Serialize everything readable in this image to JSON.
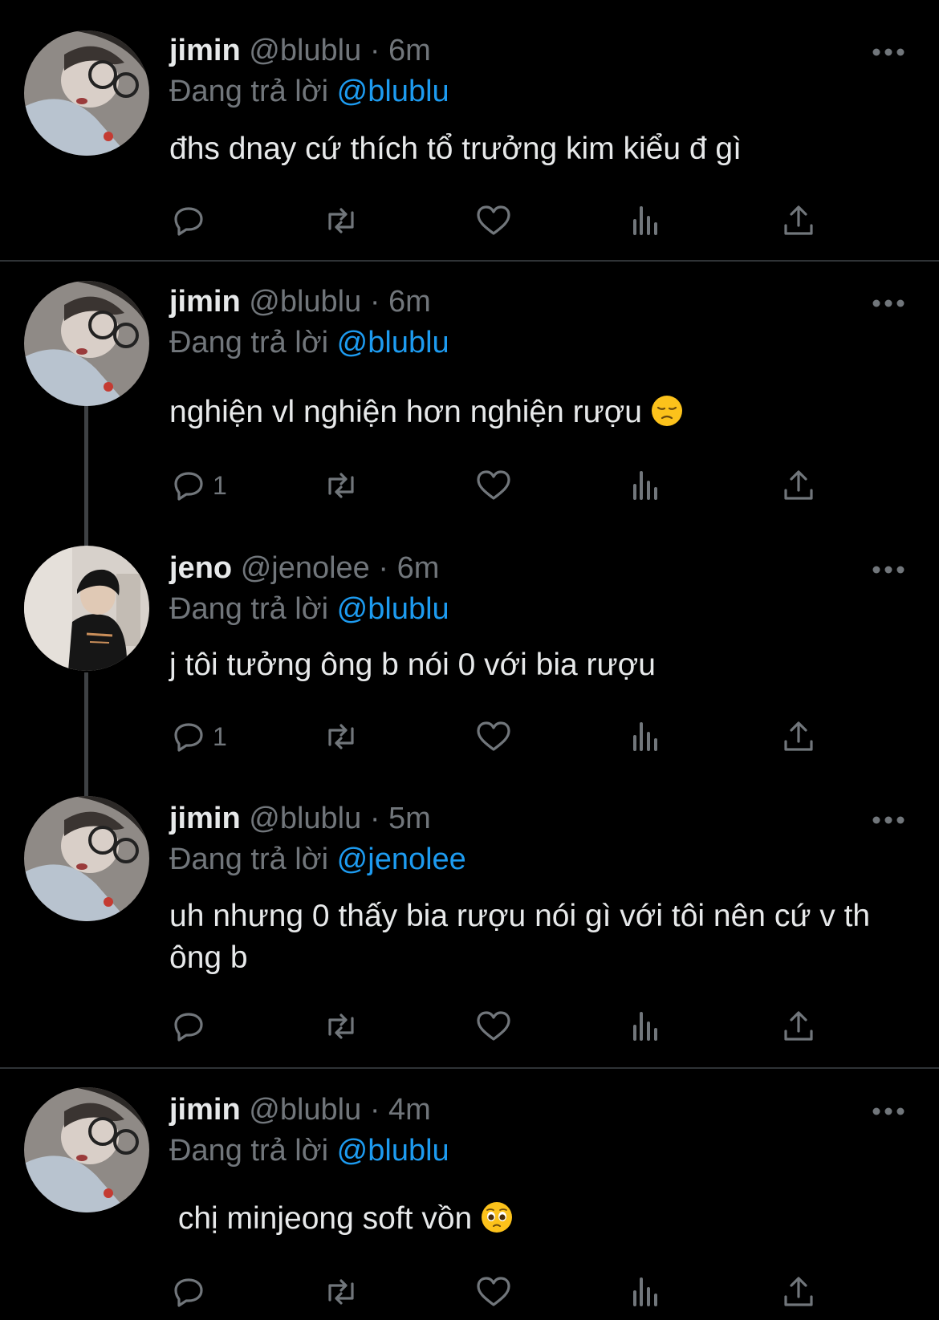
{
  "tweets": [
    {
      "name": "jimin",
      "handle": "@blublu",
      "time": "6m",
      "replying_label": "Đang trả lời",
      "replying_to": "@blublu",
      "text": "đhs dnay cứ thích tổ trưởng kim kiểu đ gì",
      "reply_count": "",
      "avatar": "jimin"
    },
    {
      "name": "jimin",
      "handle": "@blublu",
      "time": "6m",
      "replying_label": "Đang trả lời",
      "replying_to": "@blublu",
      "text": "nghiện vl nghiện hơn nghiện rượu",
      "emoji": "pensive-face",
      "reply_count": "1",
      "avatar": "jimin"
    },
    {
      "name": "jeno",
      "handle": "@jenolee",
      "time": "6m",
      "replying_label": "Đang trả lời",
      "replying_to": "@blublu",
      "text": "j tôi tưởng ông b nói 0 với bia rượu",
      "reply_count": "1",
      "avatar": "jeno"
    },
    {
      "name": "jimin",
      "handle": "@blublu",
      "time": "5m",
      "replying_label": "Đang trả lời",
      "replying_to": "@jenolee",
      "text": "uh nhưng 0 thấy bia rượu nói gì với tôi nên cứ v th ông b",
      "reply_count": "",
      "avatar": "jimin"
    },
    {
      "name": "jimin",
      "handle": "@blublu",
      "time": "4m",
      "replying_label": "Đang trả lời",
      "replying_to": "@blublu",
      "text": " chị minjeong soft vồn",
      "emoji": "pleading-face",
      "reply_count": "",
      "avatar": "jimin"
    }
  ],
  "separator": "·",
  "icons": [
    "more-icon",
    "reply-icon",
    "retweet-icon",
    "like-icon",
    "views-icon",
    "share-icon"
  ],
  "colors": {
    "background": "#000000",
    "text": "#e7e9ea",
    "secondary": "#71767b",
    "link": "#1d9bf0",
    "divider": "#2f3336"
  }
}
